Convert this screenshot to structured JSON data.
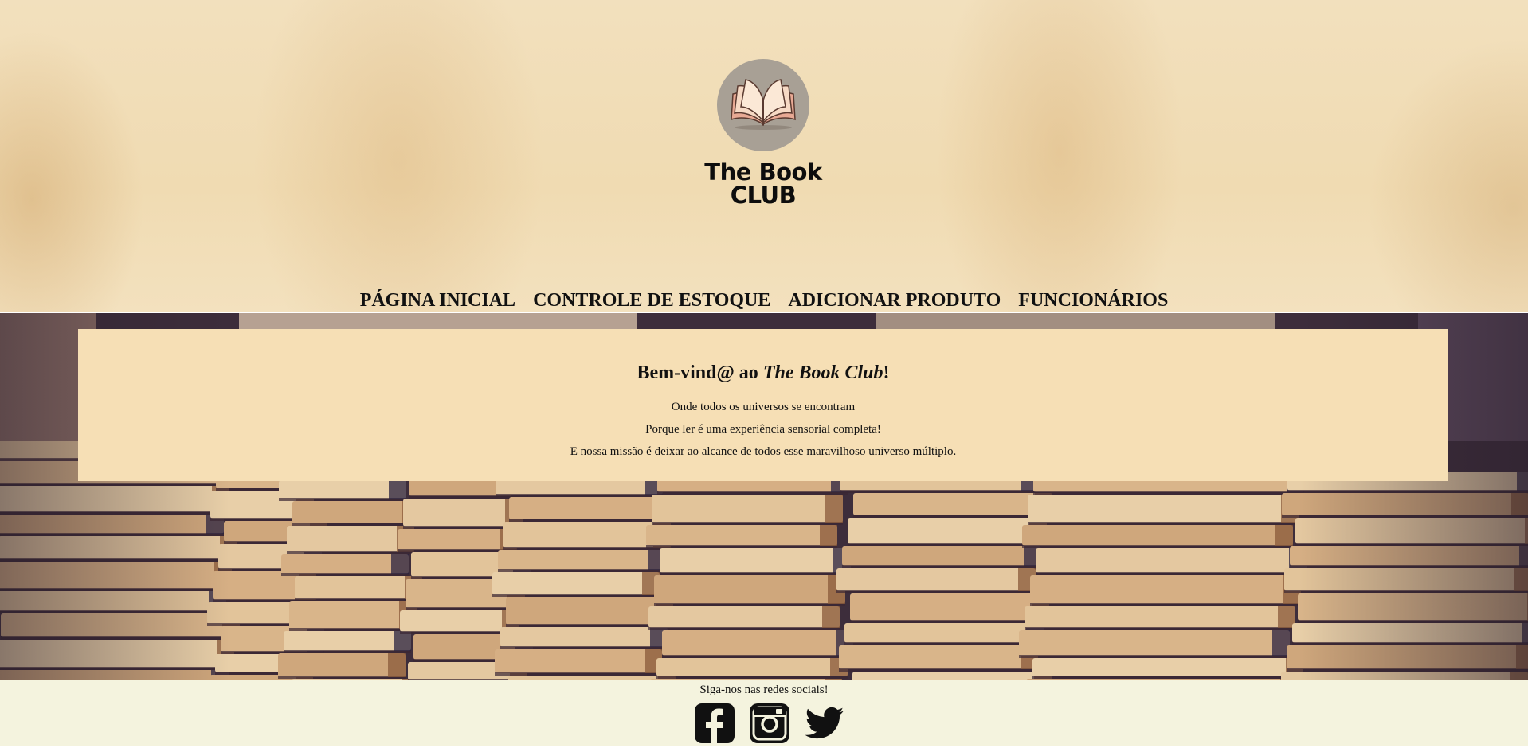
{
  "brand": {
    "line1": "The Book",
    "line2": "CLUB",
    "logo_icon": "open-book-icon"
  },
  "nav": {
    "items": [
      {
        "label": "PÁGINA INICIAL"
      },
      {
        "label": "CONTROLE DE ESTOQUE"
      },
      {
        "label": "ADICIONAR PRODUTO"
      },
      {
        "label": "FUNCIONÁRIOS"
      }
    ]
  },
  "welcome": {
    "title_prefix": "Bem-vind@ ao ",
    "title_emphasis": "The Book Club",
    "title_suffix": "!",
    "lines": [
      "Onde todos os universos se encontram",
      "Porque ler é uma experiência sensorial completa!",
      "E nossa missão é deixar ao alcance de todos esse maravilhoso universo múltiplo."
    ]
  },
  "footer": {
    "follow_text": "Siga-nos nas redes sociais!",
    "social_icons": [
      "facebook-icon",
      "instagram-icon",
      "twitter-icon"
    ]
  },
  "colors": {
    "header_bg": "#f2e0bd",
    "welcome_box_bg": "#f6dfb5",
    "footer_bg": "#f4f3de",
    "logo_circle": "#a8a095",
    "text": "#111111"
  }
}
